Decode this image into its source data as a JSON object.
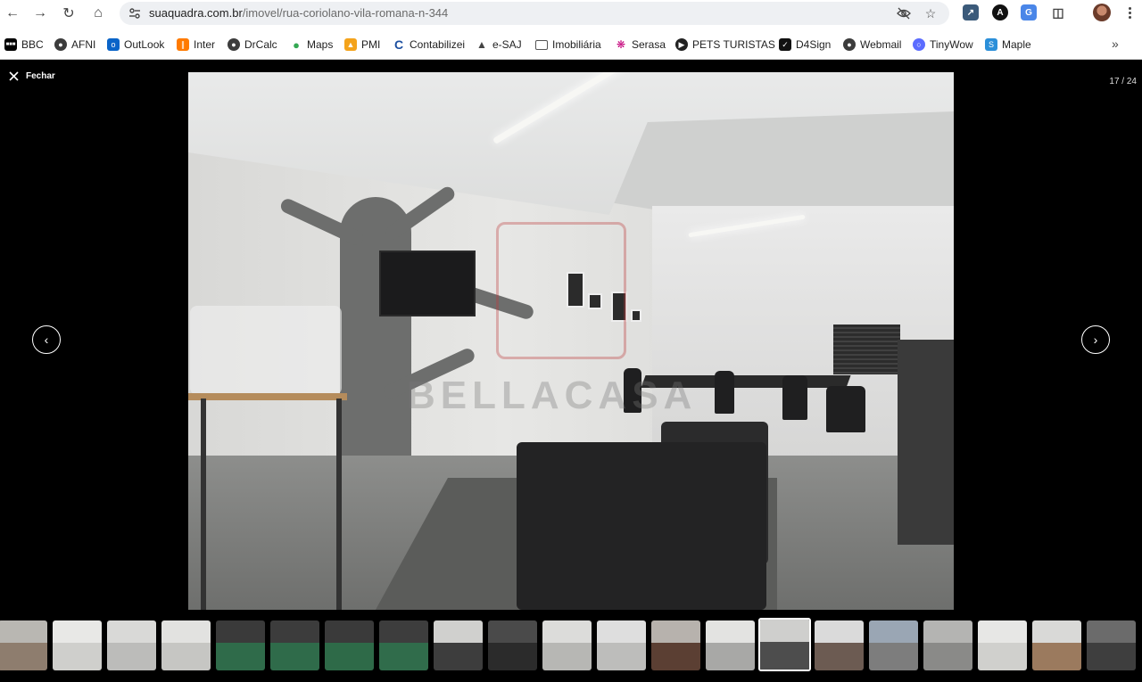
{
  "browser": {
    "url_domain": "suaquadra.com.br",
    "url_path": "/imovel/rua-coriolano-vila-romana-n-344"
  },
  "bookmarks": [
    {
      "label": "BBC",
      "icon": "bbc-icon",
      "color": "#000000"
    },
    {
      "label": "AFNI",
      "icon": "globe-icon",
      "color": "#3c3c3c"
    },
    {
      "label": "OutLook",
      "icon": "outlook-icon",
      "color": "#0a64c8"
    },
    {
      "label": "Inter",
      "icon": "inter-icon",
      "color": "#ff7a00"
    },
    {
      "label": "DrCalc",
      "icon": "globe-icon",
      "color": "#3c3c3c"
    },
    {
      "label": "Maps",
      "icon": "maps-pin-icon",
      "color": "#34a853"
    },
    {
      "label": "PMI",
      "icon": "pmi-icon",
      "color": "#f4a31b"
    },
    {
      "label": "Contabilizei",
      "icon": "contabilizei-icon",
      "color": "#1c4fa0"
    },
    {
      "label": "e-SAJ",
      "icon": "esaj-icon",
      "color": "#444444"
    },
    {
      "label": "Imobiliária",
      "icon": "folder-icon",
      "color": "#555555"
    },
    {
      "label": "Serasa",
      "icon": "serasa-icon",
      "color": "#c4007a"
    },
    {
      "label": "PETS TURISTAS",
      "icon": "pets-icon",
      "color": "#222222"
    },
    {
      "label": "D4Sign",
      "icon": "d4sign-icon",
      "color": "#111111"
    },
    {
      "label": "Webmail",
      "icon": "globe-icon",
      "color": "#3c3c3c"
    },
    {
      "label": "TinyWow",
      "icon": "tinywow-icon",
      "color": "#5b6cff"
    },
    {
      "label": "Maple",
      "icon": "maple-icon",
      "color": "#2b8fd9"
    }
  ],
  "viewer": {
    "close_label": "Fechar",
    "counter": "17 / 24",
    "current_index": 17,
    "total": 24
  },
  "watermark": {
    "text": "BELLACASA"
  },
  "thumbnails": [
    {
      "top": "#b9b7b2",
      "bottom": "#8e7d6e"
    },
    {
      "top": "#e8e8e6",
      "bottom": "#cfcfcc"
    },
    {
      "top": "#d9d9d7",
      "bottom": "#bcbcba"
    },
    {
      "top": "#e2e2e0",
      "bottom": "#c6c6c3"
    },
    {
      "top": "#3a3a3a",
      "bottom": "#2f6b4a"
    },
    {
      "top": "#3c3c3c",
      "bottom": "#2f6b4a"
    },
    {
      "top": "#3a3a3a",
      "bottom": "#2e6a48"
    },
    {
      "top": "#3d3d3d",
      "bottom": "#306c4b"
    },
    {
      "top": "#d0d0ce",
      "bottom": "#3d3d3d"
    },
    {
      "top": "#4a4a4a",
      "bottom": "#2b2b2b"
    },
    {
      "top": "#dcdcda",
      "bottom": "#b7b7b4"
    },
    {
      "top": "#dedede",
      "bottom": "#bdbdbb"
    },
    {
      "top": "#b7b2ad",
      "bottom": "#5b3f33"
    },
    {
      "top": "#e3e3e1",
      "bottom": "#a8a8a6"
    },
    {
      "top": "#cfcfcd",
      "bottom": "#4d4d4d"
    },
    {
      "top": "#dadada",
      "bottom": "#6c5b52"
    },
    {
      "top": "#9aa6b4",
      "bottom": "#7d7d7d"
    },
    {
      "top": "#b4b4b2",
      "bottom": "#8a8a88"
    },
    {
      "top": "#e7e7e5",
      "bottom": "#d0d0cd"
    },
    {
      "top": "#d9d9d7",
      "bottom": "#9b7a5e"
    },
    {
      "top": "#6b6b6b",
      "bottom": "#3e3e3e"
    }
  ]
}
